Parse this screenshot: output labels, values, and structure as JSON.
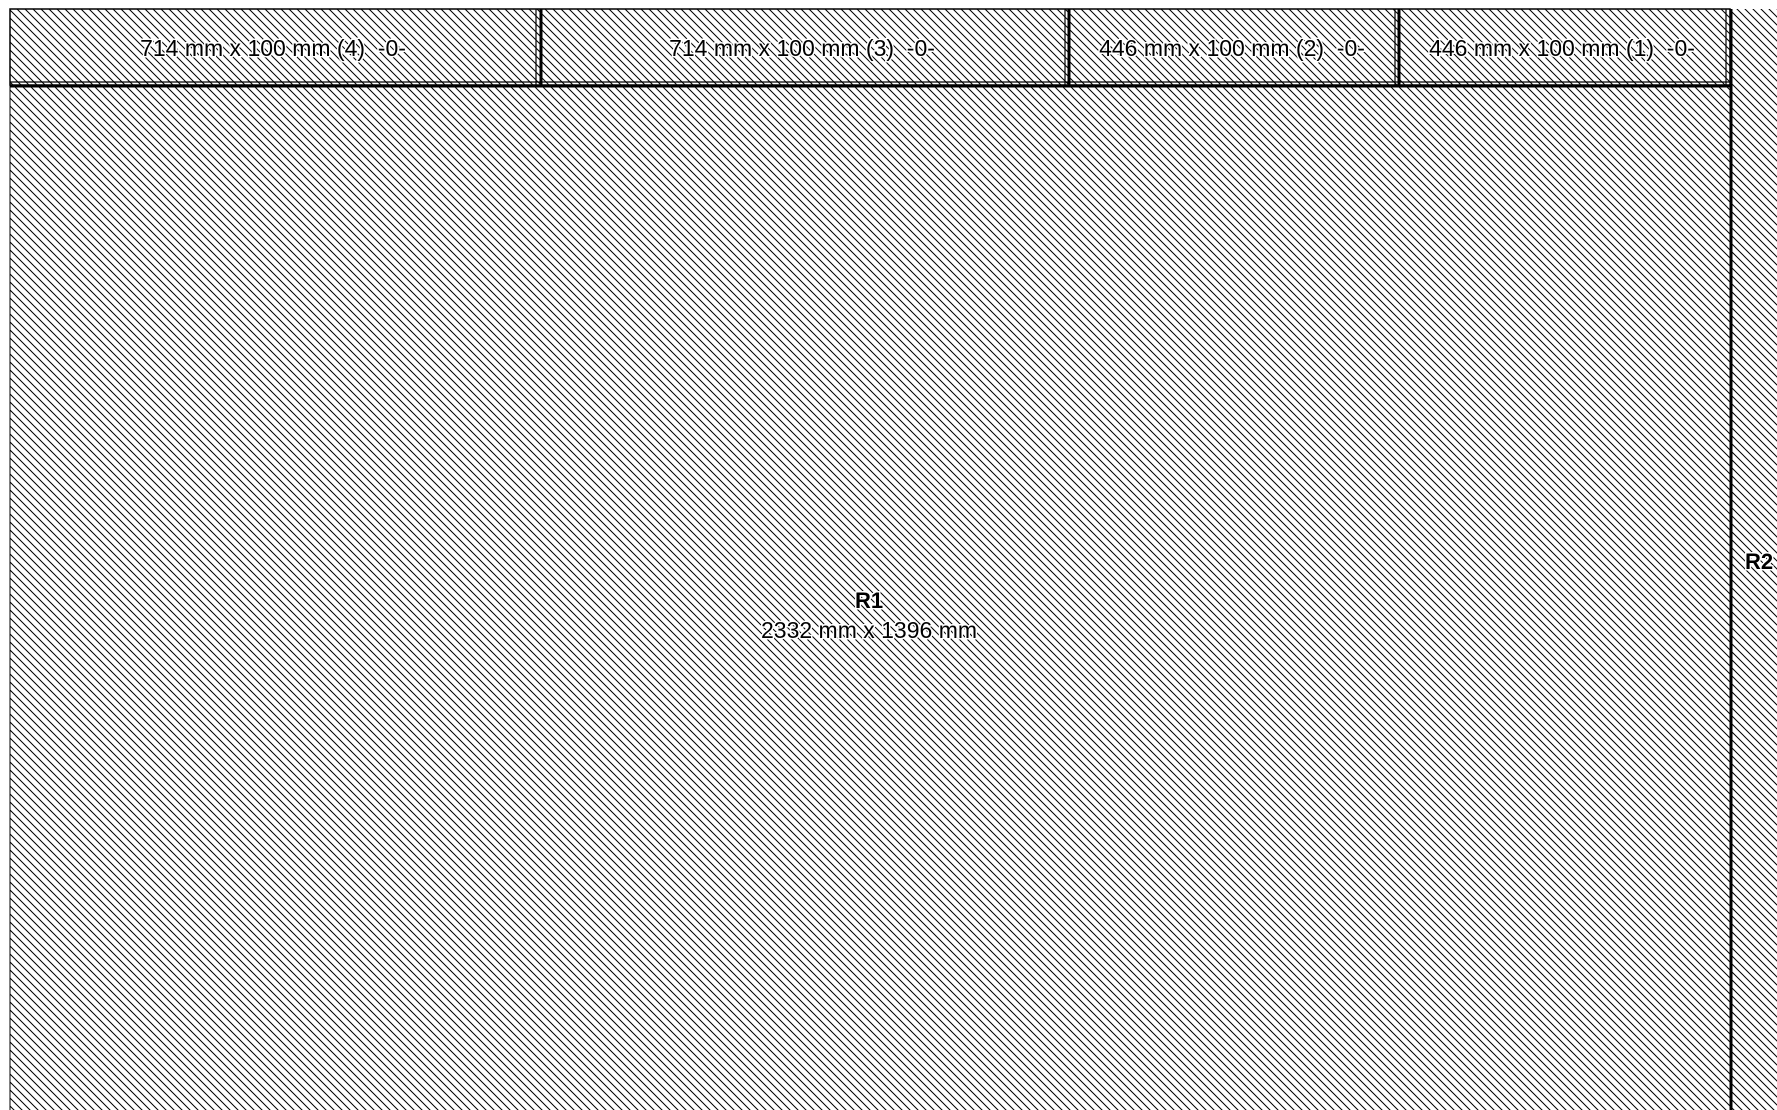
{
  "colors": {
    "background": "#ffffff",
    "outline": "#000000",
    "hatch": "#000000",
    "label_halo": "#ffffff"
  },
  "strips": [
    {
      "label": "714 mm x 100 mm (4)  -0-"
    },
    {
      "label": "714 mm x 100 mm (3)  -0-"
    },
    {
      "label": "446 mm x 100 mm (2)  -0-"
    },
    {
      "label": "446 mm x 100 mm (1)  -0-"
    }
  ],
  "regions": {
    "r1": {
      "name": "R1",
      "dims": "2332 mm x 1396 mm"
    },
    "r2": {
      "name": "R2"
    }
  }
}
